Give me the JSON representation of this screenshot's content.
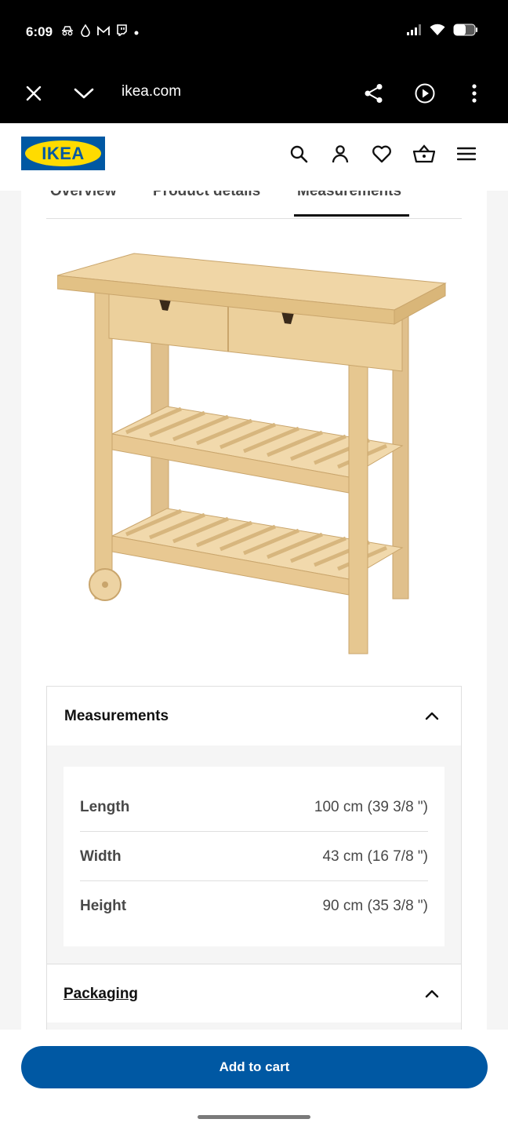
{
  "status_bar": {
    "time": "6:09",
    "notification_icons": [
      "incognito-icon",
      "water-drop-icon",
      "gmail-icon",
      "twitch-icon",
      "dot-icon"
    ],
    "system_icons": [
      "signal-icon",
      "wifi-icon",
      "battery-icon"
    ]
  },
  "browser": {
    "url": "ikea.com"
  },
  "header": {
    "logo_text": "IKEA",
    "brand_blue": "#0058a3",
    "brand_yellow": "#ffdb00"
  },
  "tabs": [
    {
      "label": "Overview"
    },
    {
      "label": "Product details"
    },
    {
      "label": "Measurements",
      "active": true
    }
  ],
  "measurements": {
    "title": "Measurements",
    "rows": [
      {
        "label": "Length",
        "value": "100 cm (39 3/8 \")"
      },
      {
        "label": "Width",
        "value": "43 cm (16 7/8 \")"
      },
      {
        "label": "Height",
        "value": "90 cm (35 3/8 \")"
      }
    ]
  },
  "packaging": {
    "title": "Packaging"
  },
  "cart": {
    "button_label": "Add to cart"
  }
}
